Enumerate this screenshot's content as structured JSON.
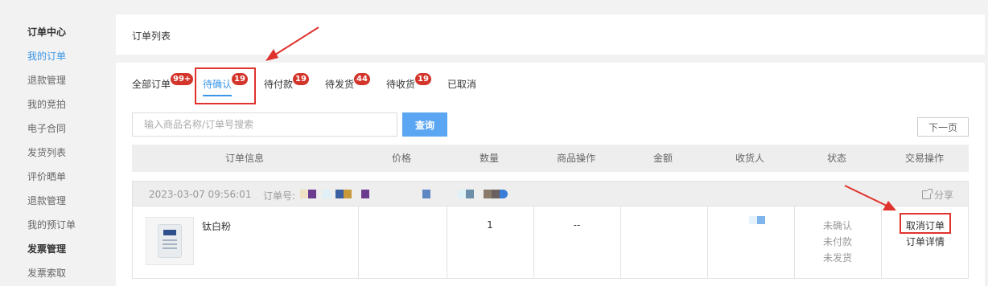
{
  "sidebar": {
    "items": [
      {
        "label": "订单中心",
        "kind": "heading"
      },
      {
        "label": "我的订单",
        "kind": "active"
      },
      {
        "label": "退款管理",
        "kind": "normal"
      },
      {
        "label": "我的竞拍",
        "kind": "normal"
      },
      {
        "label": "电子合同",
        "kind": "normal"
      },
      {
        "label": "发货列表",
        "kind": "normal"
      },
      {
        "label": "评价晒单",
        "kind": "normal"
      },
      {
        "label": "退款管理",
        "kind": "normal"
      },
      {
        "label": "我的预订单",
        "kind": "normal"
      },
      {
        "label": "发票管理",
        "kind": "heading"
      },
      {
        "label": "发票索取",
        "kind": "normal"
      }
    ]
  },
  "page": {
    "title": "订单列表"
  },
  "tabs": [
    {
      "label": "全部订单",
      "badge": "99+"
    },
    {
      "label": "待确认",
      "badge": "19",
      "active": true
    },
    {
      "label": "待付款",
      "badge": "19"
    },
    {
      "label": "待发货",
      "badge": "44"
    },
    {
      "label": "待收货",
      "badge": "19"
    },
    {
      "label": "已取消",
      "badge": ""
    }
  ],
  "search": {
    "placeholder": "输入商品名称/订单号搜索",
    "button_label": "查询",
    "next_page_label": "下一页"
  },
  "table": {
    "columns": [
      "订单信息",
      "价格",
      "数量",
      "商品操作",
      "金额",
      "收货人",
      "状态",
      "交易操作"
    ]
  },
  "order": {
    "date": "2023-03-07 09:56:01",
    "order_no_label": "订单号:",
    "share_label": "分享",
    "product_name": "钛白粉",
    "quantity": "1",
    "product_action": "--",
    "status_lines": [
      "未确认",
      "未付款",
      "未发货"
    ],
    "actions": [
      "取消订单",
      "订单详情"
    ]
  },
  "colors": {
    "accent": "#3a96e8",
    "badge": "#d3352b",
    "annotation": "#e0332e",
    "search_button": "#5aa6f2"
  }
}
